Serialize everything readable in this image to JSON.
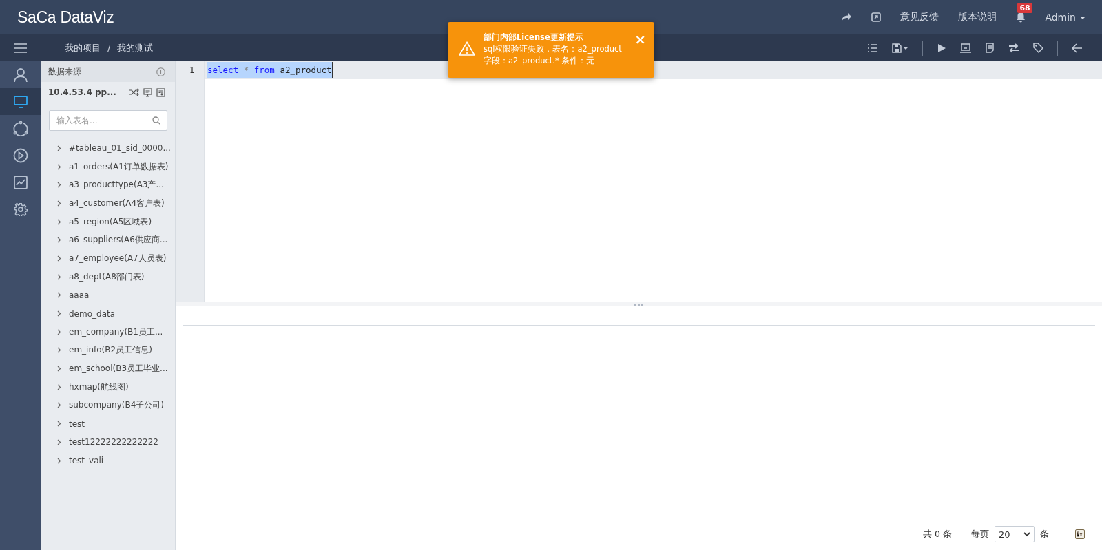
{
  "header": {
    "logo": "SaCa DataViz",
    "links": [
      "意见反馈",
      "版本说明"
    ],
    "notifications": "68",
    "user": "Admin"
  },
  "breadcrumb": [
    "我的项目",
    "我的测试"
  ],
  "breadcrumb_separator": "/",
  "rail": [
    {
      "kind": "user",
      "selected": false
    },
    {
      "kind": "monitor",
      "selected": true
    },
    {
      "kind": "cycle",
      "selected": false
    },
    {
      "kind": "play",
      "selected": false
    },
    {
      "kind": "chart",
      "selected": false
    },
    {
      "kind": "gear",
      "selected": false
    }
  ],
  "datasource": {
    "title": "数据来源",
    "connection": "10.4.53.4 pp...",
    "search_placeholder": "输入表名...",
    "tables": [
      {
        "label": "#tableau_01_sid_0000..."
      },
      {
        "label": "a1_orders(A1订单数据表)"
      },
      {
        "label": "a3_producttype(A3产..."
      },
      {
        "label": "a4_customer(A4客户表)"
      },
      {
        "label": "a5_region(A5区域表)"
      },
      {
        "label": "a6_suppliers(A6供应商..."
      },
      {
        "label": "a7_employee(A7人员表)"
      },
      {
        "label": "a8_dept(A8部门表)"
      },
      {
        "label": "aaaa"
      },
      {
        "label": "demo_data"
      },
      {
        "label": "em_company(B1员工..."
      },
      {
        "label": "em_info(B2员工信息)"
      },
      {
        "label": "em_school(B3员工毕业..."
      },
      {
        "label": "hxmap(航线图)"
      },
      {
        "label": "subcompany(B4子公司)"
      },
      {
        "label": "test"
      },
      {
        "label": "test12222222222222"
      },
      {
        "label": "test_vali"
      }
    ]
  },
  "editor": {
    "line_number": "1",
    "tokens": [
      {
        "text": "select",
        "kind": "keyword"
      },
      {
        "text": "*",
        "kind": "operator"
      },
      {
        "text": "from",
        "kind": "keyword"
      },
      {
        "text": "a2_product",
        "kind": "name"
      }
    ]
  },
  "toast": {
    "title": "部门内部License更新提示",
    "message": "sql权限验证失败，表名：a2_product 字段：a2_product.* 条件：无",
    "close": "×"
  },
  "pagination": {
    "total": "共 0 条",
    "per_page_label": "每页",
    "per_page": "20",
    "unit": "条"
  }
}
